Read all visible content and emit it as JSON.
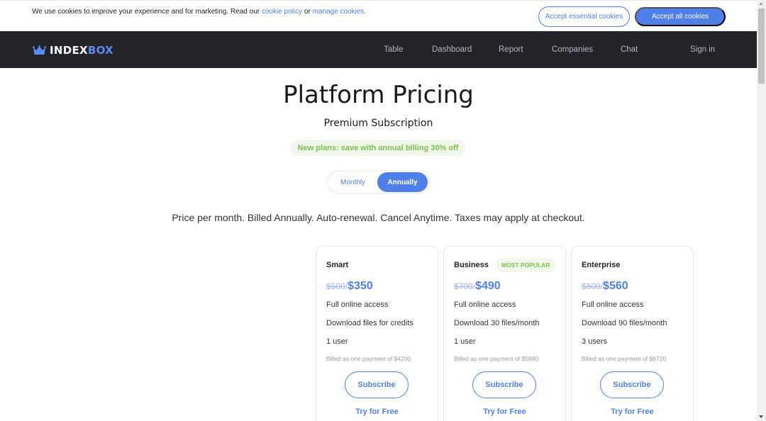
{
  "cookie": {
    "text_before": "We use cookies to improve your experience and for marketing. Read our ",
    "policy_link": "cookie policy",
    "text_or": " or ",
    "manage_link": "manage cookies.",
    "essential_button": "Accept essential cookies",
    "all_button": "Accept all cookies"
  },
  "brand": {
    "index": "INDEX",
    "box": "BOX",
    "accent": "#5b8af0"
  },
  "nav": {
    "links": [
      "Table",
      "Dashboard",
      "Report",
      "Companies",
      "Chat"
    ],
    "signin": "Sign in"
  },
  "page": {
    "title": "Platform Pricing",
    "subtitle": "Premium Subscription",
    "promo": "New plans: save with annual billing 30% off",
    "toggle": {
      "monthly": "Monthly",
      "annually": "Annually",
      "selected": "Annually"
    },
    "price_note": "Price per month. Billed Annually. Auto-renewal. Cancel Anytime. Taxes may apply at checkout."
  },
  "plans": [
    {
      "name": "Smart",
      "badge": "",
      "old_price": "$500",
      "new_price": "$350",
      "features": [
        "Full online access",
        "Download files for credits",
        "1 user"
      ],
      "billed": "Billed as one payment of $4200",
      "subscribe": "Subscribe",
      "try": "Try for Free"
    },
    {
      "name": "Business",
      "badge": "MOST POPULAR",
      "old_price": "$700",
      "new_price": "$490",
      "features": [
        "Full online access",
        "Download 30 files/month",
        "1 user"
      ],
      "billed": "Billed as one payment of $5880",
      "subscribe": "Subscribe",
      "try": "Try for Free"
    },
    {
      "name": "Enterprise",
      "badge": "",
      "old_price": "$800",
      "new_price": "$560",
      "features": [
        "Full online access",
        "Download 90 files/month",
        "3 users"
      ],
      "billed": "Billed as one payment of $6720",
      "subscribe": "Subscribe",
      "try": "Try for Free"
    }
  ],
  "colors": {
    "primary": "#4f7fe8",
    "nav_bg": "#23232a",
    "promo_green": "#7bc04a"
  }
}
